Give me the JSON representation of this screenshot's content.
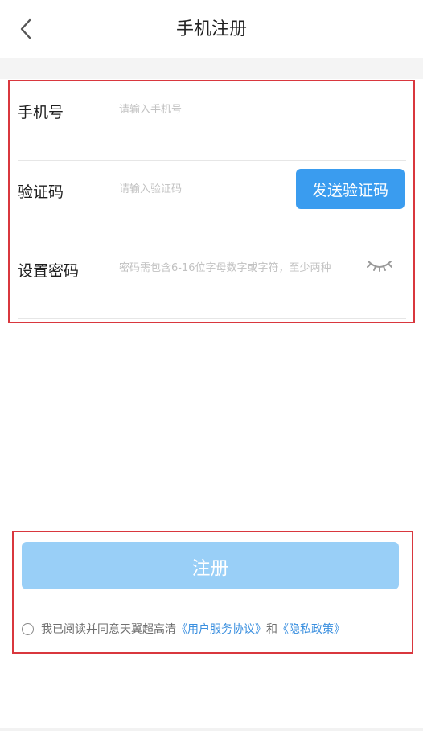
{
  "header": {
    "title": "手机注册",
    "back_icon": "chevron-left-icon"
  },
  "form": {
    "phone": {
      "label": "手机号",
      "placeholder": "请输入手机号",
      "value": ""
    },
    "code": {
      "label": "验证码",
      "placeholder": "请输入验证码",
      "value": "",
      "send_button_label": "发送验证码"
    },
    "password": {
      "label": "设置密码",
      "placeholder": "密码需包含6-16位字母数字或字符，至少两种",
      "value": "",
      "visibility_icon": "eye-closed-icon"
    }
  },
  "footer": {
    "register_label": "注册",
    "agreement": {
      "prefix": "我已阅读并同意天翼超高清",
      "service_link": "《用户服务协议》",
      "and": "和",
      "privacy_link": "《隐私政策》",
      "checked": false
    }
  },
  "colors": {
    "accent": "#3a9cef",
    "register_disabled": "#99cff7",
    "link": "#3a8fdf",
    "highlight_border": "#d9373e"
  }
}
